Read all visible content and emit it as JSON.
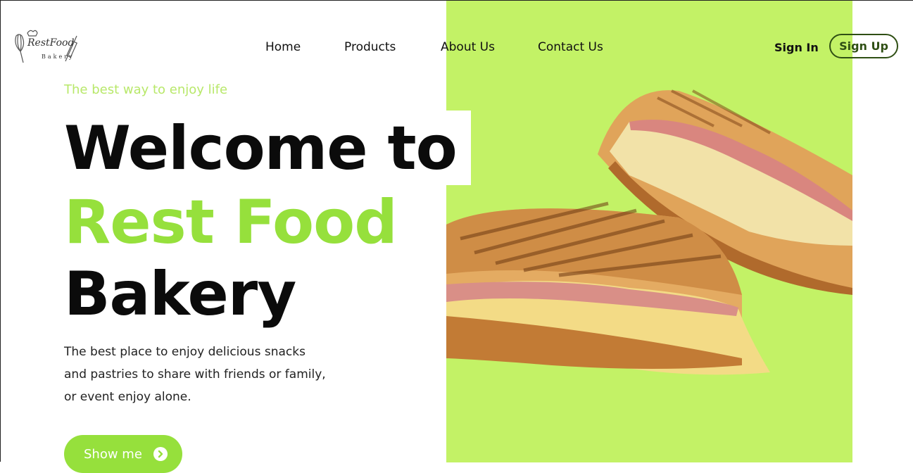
{
  "brand": {
    "logo_top": "RestFood",
    "logo_bottom": "Bakery"
  },
  "nav": {
    "items": [
      {
        "label": "Home"
      },
      {
        "label": "Products"
      },
      {
        "label": "About Us"
      },
      {
        "label": "Contact Us"
      }
    ],
    "sign_in": "Sign In",
    "sign_up": "Sign Up"
  },
  "hero": {
    "tagline": "The best way to enjoy life",
    "heading_line1": "Welcome to",
    "heading_line2": "Rest Food",
    "heading_line3": "Bakery",
    "description": "The best place to enjoy delicious snacks and pastries to share with friends or family, or event enjoy alone.",
    "cta_label": "Show me",
    "cta_icon": "chevron-right-circle-icon",
    "image": "grilled-sandwich-image"
  },
  "colors": {
    "accent_green": "#96e03c",
    "panel_green": "#c3f266",
    "dark_green": "#2f4f14",
    "tagline_green": "#b8e86a"
  }
}
